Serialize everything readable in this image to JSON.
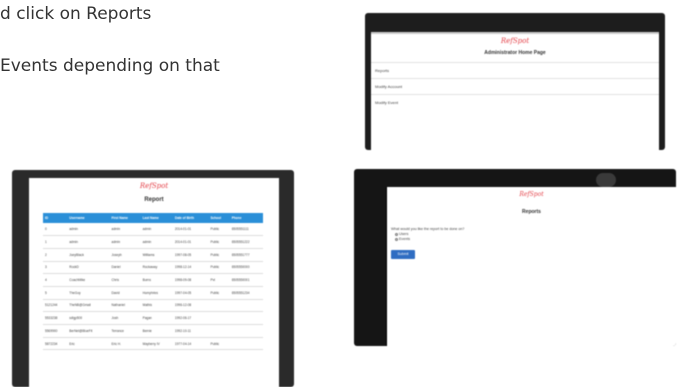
{
  "instructions": {
    "line1": "d click on Reports",
    "line2": "Events depending on that"
  },
  "app": {
    "logo": "RefSpot"
  },
  "admin_home": {
    "title": "Administrator Home Page",
    "links": [
      "Reports",
      "Modify Account",
      "Modify Event"
    ]
  },
  "report_page": {
    "title": "Report",
    "columns": [
      "ID",
      "Username",
      "First Name",
      "Last Name",
      "Date of Birth",
      "School",
      "Phone"
    ],
    "rows": [
      [
        "0",
        "admin",
        "admin",
        "admin",
        "2014-01-01",
        "Public",
        "6505551111"
      ],
      [
        "1",
        "admin",
        "admin",
        "admin",
        "2014-01-01",
        "Public",
        "6505551222"
      ],
      [
        "2",
        "JoeyBlack",
        "Joseph",
        "Williams",
        "1997-08-05",
        "Public",
        "6505551777"
      ],
      [
        "3",
        "RockD",
        "Daniel",
        "Rockaway",
        "1998-12-14",
        "Public",
        "6505550000"
      ],
      [
        "4",
        "CoachMike",
        "Chris",
        "Burns",
        "1998-09-08",
        "Pvt",
        "6505550001"
      ],
      [
        "5",
        "TheGuy",
        "David",
        "Humphries",
        "1997-04-05",
        "Public",
        "6505551234"
      ],
      [
        "5121244",
        "TheNB@Gmail",
        "Nathaniel",
        "Mathis",
        "1996-12-08",
        "",
        ""
      ],
      [
        "5533238",
        "sdlgp500",
        "Josh",
        "Pagan",
        "1992-06-17",
        "",
        ""
      ],
      [
        "5569900",
        "BerNet@BlueFit",
        "Terrance",
        "Bernie",
        "1992-10-11",
        "",
        ""
      ],
      [
        "5872234",
        "Eric",
        "Eric H.",
        "Mayberry IV",
        "1977-04-14",
        "Public",
        ""
      ]
    ]
  },
  "reports_page": {
    "title": "Reports",
    "question": "What would you like the report to be done on?",
    "options": [
      "Users",
      "Events"
    ],
    "submit_label": "Submit"
  }
}
